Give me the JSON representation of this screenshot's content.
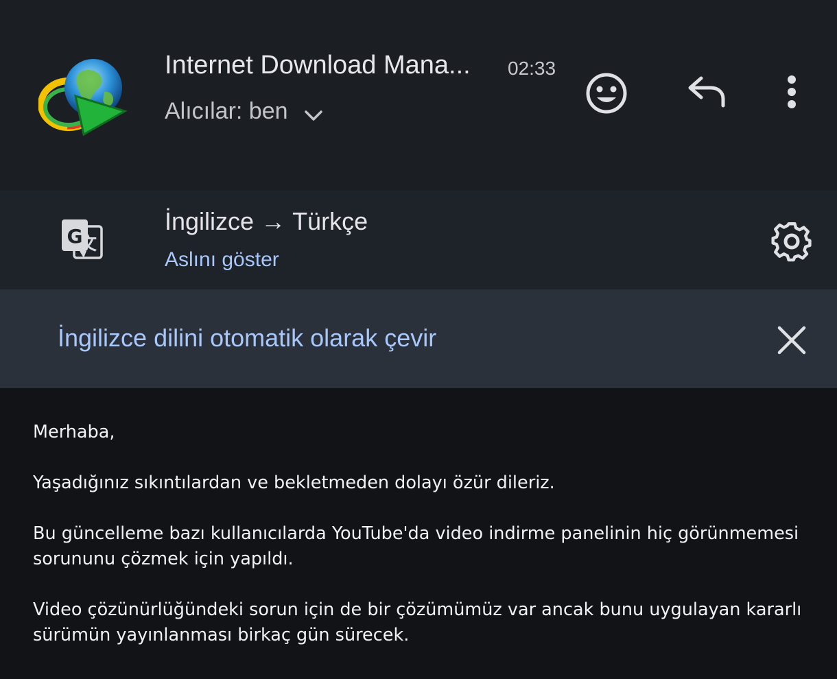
{
  "header": {
    "sender": "Internet Download Mana...",
    "time": "02:33",
    "recipients": "Alıcılar: ben",
    "icons": {
      "avatar": "idm-logo-icon",
      "expand": "chevron-down-icon",
      "emoji": "emoji-react-icon",
      "reply": "reply-icon",
      "more": "more-vert-icon"
    }
  },
  "translate": {
    "source_lang": "İngilizce",
    "arrow": "→",
    "target_lang": "Türkçe",
    "show_original": "Aslını göster",
    "icons": {
      "translate": "translate-icon",
      "settings": "gear-icon"
    }
  },
  "auto_translate": {
    "text": "İngilizce dilini otomatik olarak çevir",
    "close_icon": "close-icon"
  },
  "body": {
    "greeting": "Merhaba,",
    "p1": "Yaşadığınız sıkıntılardan ve bekletmeden dolayı özür dileriz.",
    "p2_line1": "Bu güncelleme bazı kullanıcılarda YouTube'da video indirme panelinin hiç görünmemesi",
    "p2_line2": "sorununu çözmek için yapıldı.",
    "p3_line1": "Video çözünürlüğündeki sorun için de bir çözümümüz var ancak bunu uygulayan kararlı",
    "p3_line2": "sürümün yayınlanması birkaç gün sürecek."
  },
  "colors": {
    "background": "#121317",
    "header_bg": "#1b1e23",
    "translate_bg": "#1e2229",
    "banner_bg": "#2a313b",
    "link": "#a8c7fa"
  }
}
